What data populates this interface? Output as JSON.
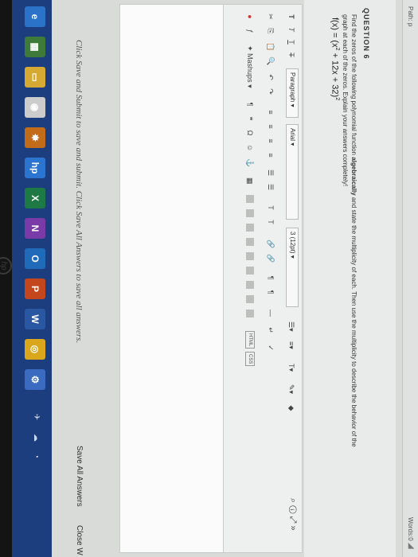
{
  "editor": {
    "path_label": "Path: p",
    "word_count": "Words:0",
    "question_title": "QUESTION 6",
    "question_part1": "Find the zeros of the following polynomial function ",
    "question_bold": "algebraically",
    "question_part2": " and state the multiplicity of each. Then use the multiplicity to describe the behavior of the graph at each of the zeros. Explain your answers completely!",
    "formula_left": "f(x) = (x",
    "formula_exp1": "2",
    "formula_mid": " + 12x + 32)",
    "formula_exp2": "2"
  },
  "toolbar": {
    "row1": {
      "format_buttons": [
        "T",
        "T",
        "T",
        "T"
      ],
      "paragraph_select": "Paragraph",
      "font_select": "Arial",
      "size_select": "3 (12pt)"
    },
    "row2_glyphs": [
      "✂",
      "⎘",
      "📋",
      "🔍",
      "↶",
      "↷",
      "≡",
      "≡",
      "≡",
      "≡",
      "☰",
      "☰",
      "T",
      "T",
      "🔗",
      "🔗",
      "¶",
      "¶",
      "—",
      "↵",
      "✓"
    ],
    "mashups_label": "Mashups",
    "chips": [
      "HTML",
      "CSS"
    ]
  },
  "footer": {
    "instruction": "Click Save and Submit to save and submit. Click Save All Answers to save all answers.",
    "save_all": "Save All Answers",
    "close_window": "Close W"
  },
  "taskbar": {
    "apps": [
      {
        "name": "edge",
        "glyph": "e",
        "color": "#2b73c8"
      },
      {
        "name": "store",
        "glyph": "▦",
        "color": "#3e7b3a"
      },
      {
        "name": "files",
        "glyph": "▭",
        "color": "#d6a933"
      },
      {
        "name": "photos",
        "glyph": "◉",
        "color": "#cccccc"
      },
      {
        "name": "app",
        "glyph": "✸",
        "color": "#c26b19"
      },
      {
        "name": "hp",
        "glyph": "hp",
        "color": "#2b74d0"
      },
      {
        "name": "excel",
        "glyph": "X",
        "color": "#1d7a45"
      },
      {
        "name": "onenote",
        "glyph": "N",
        "color": "#7a3aa8"
      },
      {
        "name": "outlook",
        "glyph": "O",
        "color": "#1f6ab9"
      },
      {
        "name": "powerpoint",
        "glyph": "P",
        "color": "#c4461d"
      },
      {
        "name": "word",
        "glyph": "W",
        "color": "#2a57a2"
      },
      {
        "name": "chrome",
        "glyph": "◎",
        "color": "#d9a61c"
      },
      {
        "name": "settings",
        "glyph": "⚙",
        "color": "#3a6bc0"
      }
    ]
  }
}
